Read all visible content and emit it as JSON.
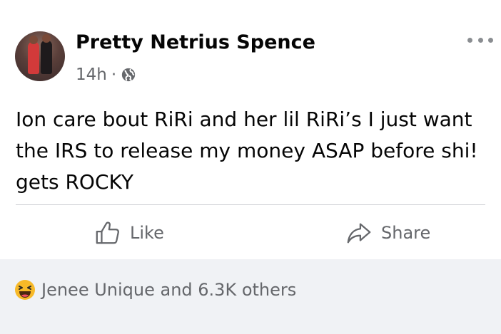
{
  "post": {
    "author": "Pretty Netrius Spence",
    "time": "14h",
    "separator": "·",
    "text": "Ion care bout RiRi and her lil RiRi’s I just want the IRS to release my money ASAP before shi! gets ROCKY",
    "privacy_icon": "globe-icon",
    "menu_icon": "more-horizontal-icon"
  },
  "actions": {
    "like_label": "Like",
    "like_icon": "thumbs-up-icon",
    "share_label": "Share",
    "share_icon": "share-arrow-icon"
  },
  "reactions": {
    "icon": "haha-emoji-icon",
    "summary": "Jenee Unique and 6.3K others"
  },
  "colors": {
    "card_bg": "#ffffff",
    "page_bg": "#f0f2f5",
    "primary_text": "#050505",
    "secondary_text": "#65676b",
    "divider": "#ced0d4",
    "haha_yellow": "#f7b928"
  }
}
